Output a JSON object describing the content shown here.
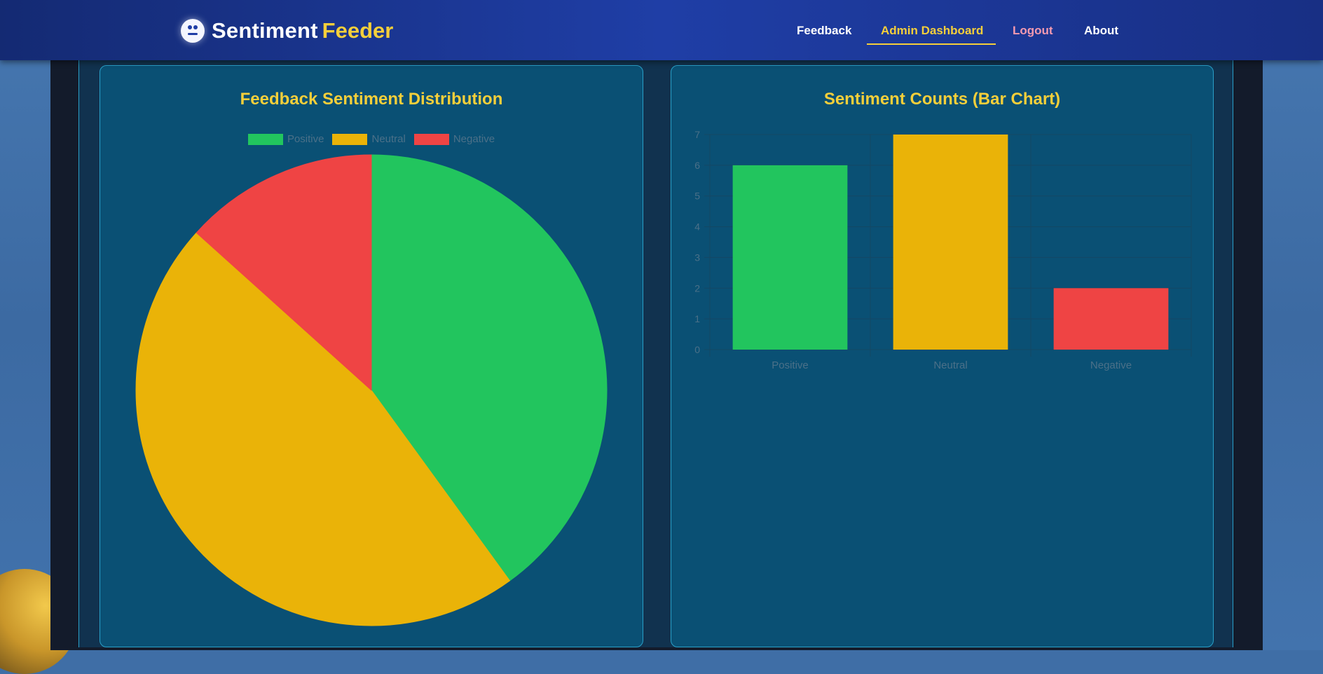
{
  "app": {
    "brand_main": "Sentiment",
    "brand_accent": "Feeder",
    "brand_icon": "face-icon"
  },
  "nav": {
    "feedback": "Feedback",
    "admin_dashboard": "Admin Dashboard",
    "logout": "Logout",
    "about": "About",
    "active": "Admin Dashboard"
  },
  "colors": {
    "positive": "#22c55e",
    "neutral": "#eab308",
    "negative": "#ef4444",
    "title": "#f5cf3a"
  },
  "pie_card": {
    "title": "Feedback Sentiment Distribution"
  },
  "bar_card": {
    "title": "Sentiment Counts (Bar Chart)"
  },
  "chart_data": [
    {
      "type": "pie",
      "title": "Feedback Sentiment Distribution",
      "categories": [
        "Positive",
        "Neutral",
        "Negative"
      ],
      "values": [
        6,
        7,
        2
      ],
      "legend": "top"
    },
    {
      "type": "bar",
      "title": "Sentiment Counts (Bar Chart)",
      "categories": [
        "Positive",
        "Neutral",
        "Negative"
      ],
      "values": [
        6,
        7,
        2
      ],
      "ylim": [
        0,
        7
      ],
      "yticks": [
        "0",
        "1",
        "2",
        "3",
        "4",
        "5",
        "6",
        "7"
      ],
      "grid": true
    }
  ]
}
